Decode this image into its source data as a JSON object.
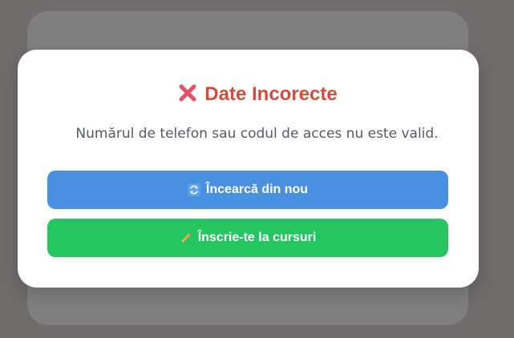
{
  "modal": {
    "title": "Date Incorecte",
    "message": "Numărul de telefon sau codul de acces nu este valid.",
    "title_color": "#d84b3b",
    "title_icon": "cross-mark-icon"
  },
  "buttons": {
    "retry": {
      "label": "Încearcă din nou",
      "icon": "refresh-icon",
      "color": "#4a90e2"
    },
    "enroll": {
      "label": "Înscrie-te la cursuri",
      "icon": "pencil-icon",
      "color": "#23c65f"
    }
  }
}
